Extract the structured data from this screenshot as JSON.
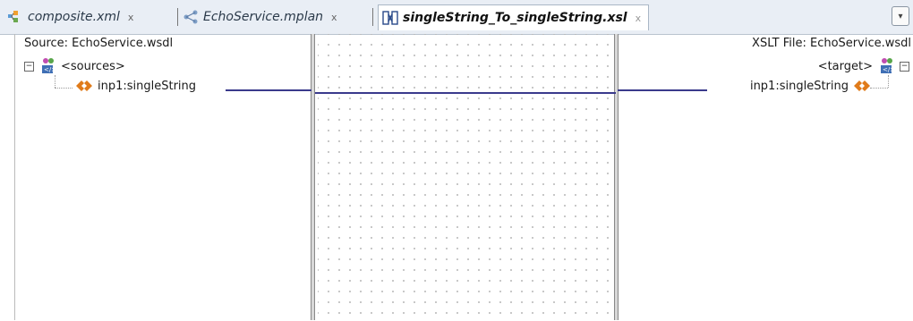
{
  "tabs": [
    {
      "label": "composite.xml",
      "close": "x",
      "icon": "composite-icon",
      "active": false
    },
    {
      "label": "EchoService.mplan",
      "close": "x",
      "icon": "mplan-icon",
      "active": false
    },
    {
      "label": "singleString_To_singleString.xsl",
      "close": "x",
      "icon": "xsl-map-icon",
      "active": true
    }
  ],
  "tab_menu_icon": "▾",
  "source": {
    "title": "Source: EchoService.wsdl",
    "root_label": "<sources>",
    "root_expander": "−",
    "child_label": "inp1:singleString"
  },
  "target": {
    "title": "XSLT File: EchoService.wsdl",
    "root_label": "<target>",
    "root_expander": "−",
    "child_label": "inp1:singleString"
  },
  "colors": {
    "mapping_line": "#3a3a8c",
    "element_icon": "#e07b1a",
    "active_tab": "#ffffff"
  }
}
